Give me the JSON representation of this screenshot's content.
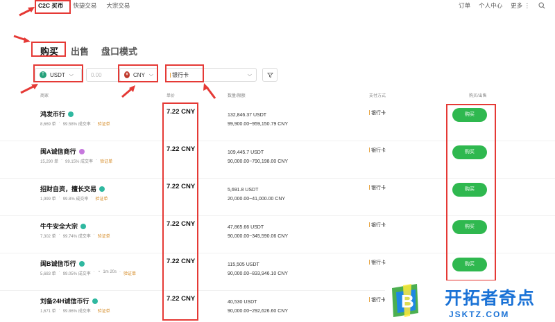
{
  "topnav": {
    "items": [
      "C2C 买币",
      "快捷交易",
      "大宗交易"
    ],
    "active": 0
  },
  "topright": {
    "items": [
      "订单",
      "个人中心",
      "更多"
    ]
  },
  "mainnav": {
    "tabs": [
      "购买",
      "出售",
      "盘口模式"
    ]
  },
  "filters": {
    "coin": "USDT",
    "amount_placeholder": "0.00",
    "fiat": "CNY",
    "payment": "银行卡"
  },
  "headers": {
    "merchant": "商家",
    "price": "单价",
    "qty": "数量/限额",
    "pay": "支付方式",
    "action": "购买/出售"
  },
  "rows": [
    {
      "name": "鸿发币行",
      "orders": "8,669 单",
      "rate": "99.58% 成交率",
      "time": "",
      "verify": "验证单",
      "price": "7.22 CNY",
      "amount": "132,846.37 USDT",
      "limit": "99,900.00~959,150.79 CNY",
      "pay": "银行卡",
      "btn": "购买",
      "badge": "#2fb8a0"
    },
    {
      "name": "闽A诚信商行",
      "orders": "15,290 单",
      "rate": "99.15% 成交率",
      "time": "",
      "verify": "验证单",
      "price": "7.22 CNY",
      "amount": "109,445.7 USDT",
      "limit": "90,000.00~790,198.00 CNY",
      "pay": "银行卡",
      "btn": "购买",
      "badge": "#c678dd"
    },
    {
      "name": "招财自资，擅长交易",
      "orders": "1,999 单",
      "rate": "99.8% 成交率",
      "time": "",
      "verify": "验证单",
      "price": "7.22 CNY",
      "amount": "5,691.8 USDT",
      "limit": "20,000.00~41,000.00 CNY",
      "pay": "银行卡",
      "btn": "购买",
      "badge": "#2fb8a0"
    },
    {
      "name": "牛牛安全大宗",
      "orders": "7,302 单",
      "rate": "99.74% 成交率",
      "time": "",
      "verify": "验证单",
      "price": "7.22 CNY",
      "amount": "47,865.66 USDT",
      "limit": "90,000.00~345,590.06 CNY",
      "pay": "银行卡",
      "btn": "购买",
      "badge": "#2fb8a0"
    },
    {
      "name": "闽B诚信币行",
      "orders": "5,683 单",
      "rate": "99.05% 成交率",
      "time": "1m 20s",
      "verify": "验证单",
      "price": "7.22 CNY",
      "amount": "115,505 USDT",
      "limit": "90,000.00~833,946.10 CNY",
      "pay": "银行卡",
      "btn": "购买",
      "badge": "#2fb8a0"
    },
    {
      "name": "刘备24H诚信币行",
      "orders": "1,671 单",
      "rate": "99.86% 成交率",
      "time": "",
      "verify": "验证单",
      "price": "7.22 CNY",
      "amount": "40,530 USDT",
      "limit": "90,000.00~292,626.60 CNY",
      "pay": "银行卡",
      "btn": "购买",
      "badge": "#2fb8a0"
    }
  ],
  "watermark": {
    "title": "开拓者奇点",
    "url": "JSKTZ.COM",
    "logo_letter": "B"
  },
  "colors": {
    "buy_green": "#2fb84f",
    "highlight_red": "#e53935",
    "verify_orange": "#d58a24",
    "brand_blue": "#1a72d6"
  }
}
